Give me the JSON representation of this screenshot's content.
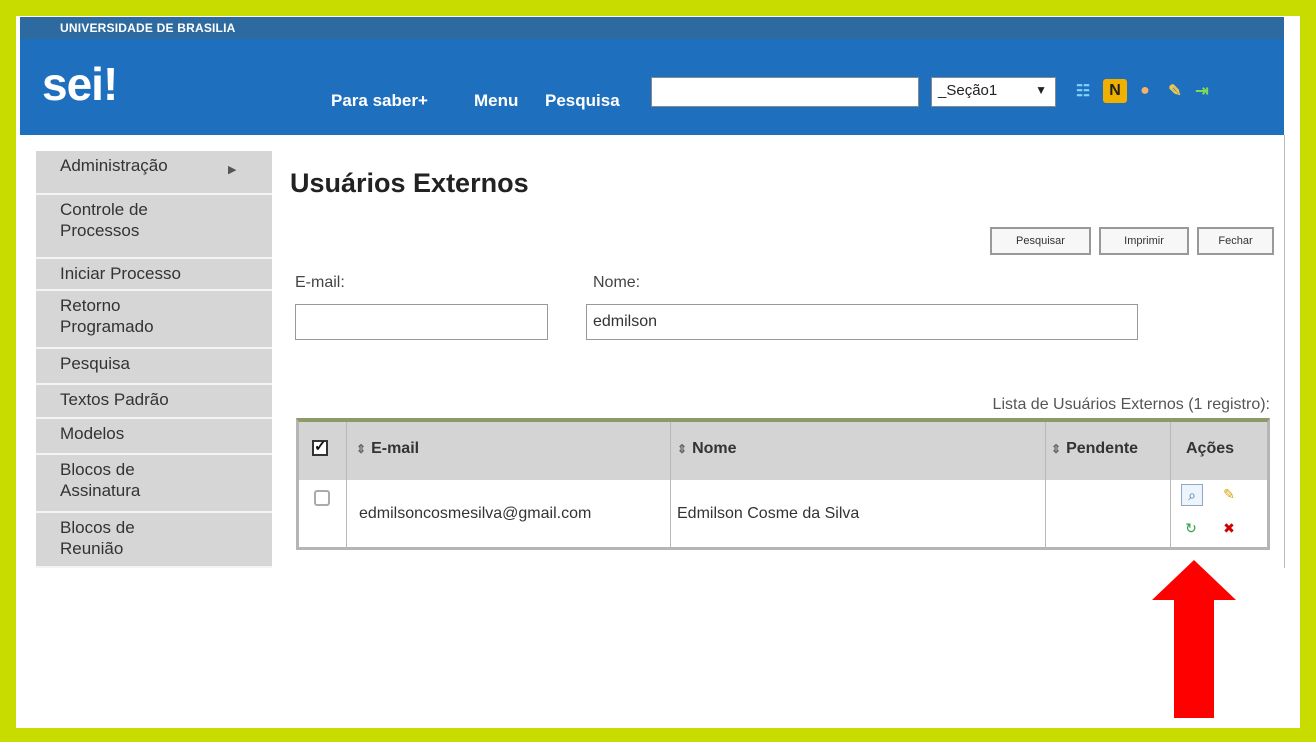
{
  "header": {
    "institution": "UNIVERSIDADE DE BRASILIA",
    "logo": "sei!",
    "nav": [
      "Para saber+",
      "Menu",
      "Pesquisa"
    ],
    "search_value": "",
    "unit_select": "_Seção1",
    "icons": [
      "grid-icon",
      "notes-icon",
      "user-icon",
      "wrench-icon",
      "exit-icon"
    ],
    "colors": {
      "top_strip": "#2d6a9f",
      "header": "#1f6fbf",
      "outer_border": "#c8dc00"
    }
  },
  "sidebar": {
    "items": [
      {
        "label": "Administração",
        "has_submenu": true
      },
      {
        "label": "Controle de Processos"
      },
      {
        "label": "Iniciar Processo"
      },
      {
        "label": "Retorno Programado"
      },
      {
        "label": "Pesquisa"
      },
      {
        "label": "Textos Padrão"
      },
      {
        "label": "Modelos"
      },
      {
        "label": "Blocos de Assinatura"
      },
      {
        "label": "Blocos de Reunião"
      }
    ]
  },
  "main": {
    "title": "Usuários Externos",
    "buttons": [
      "Pesquisar",
      "Imprimir",
      "Fechar"
    ],
    "email_label": "E-mail:",
    "email_value": "",
    "nome_label": "Nome:",
    "nome_value": "edmilson",
    "list_caption": "Lista de Usuários Externos (1 registro):",
    "table": {
      "headers": [
        "E-mail",
        "Nome",
        "Pendente",
        "Ações"
      ],
      "rows": [
        {
          "email": "edmilsoncosmesilva@gmail.com",
          "nome": "Edmilson Cosme da Silva",
          "pendente": "",
          "actions": [
            "view-icon",
            "edit-icon",
            "reactivate-icon",
            "delete-icon"
          ]
        }
      ]
    }
  },
  "annotation": {
    "arrow_color": "#ff0000"
  }
}
